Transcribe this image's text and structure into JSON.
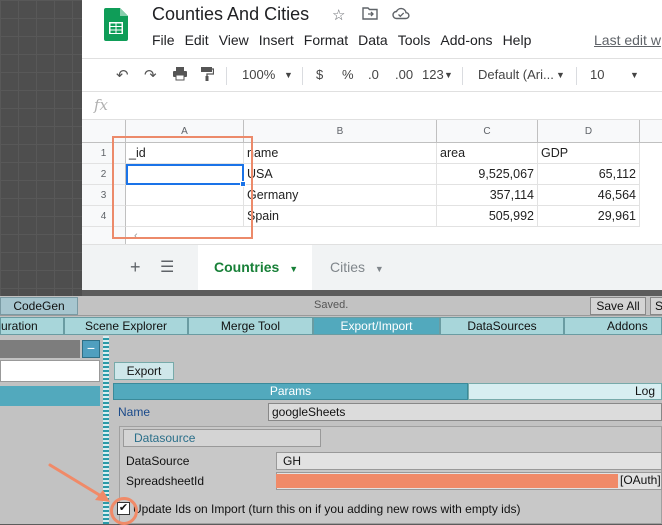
{
  "sheets": {
    "title": "Counties And Cities",
    "icons": {
      "star": "star-icon",
      "move": "folder-move-icon",
      "cloud": "cloud-saved-icon"
    },
    "menu": [
      "File",
      "Edit",
      "View",
      "Insert",
      "Format",
      "Data",
      "Tools",
      "Add-ons",
      "Help"
    ],
    "last_edit": "Last edit w",
    "toolbar": {
      "zoom": "100%",
      "currency": "$",
      "percent": "%",
      "dec_decrease": ".0",
      "dec_increase": ".00",
      "more_formats": "123",
      "font": "Default (Ari...",
      "font_size": "10"
    },
    "fx": "fx",
    "columns": [
      "A",
      "B",
      "C",
      "D"
    ],
    "rows": [
      {
        "num": "1",
        "cells": [
          "_id",
          "name",
          "area",
          "GDP"
        ]
      },
      {
        "num": "2",
        "cells": [
          "",
          "USA",
          "9,525,067",
          "65,112"
        ]
      },
      {
        "num": "3",
        "cells": [
          "",
          "Germany",
          "357,114",
          "46,564"
        ]
      },
      {
        "num": "4",
        "cells": [
          "",
          "Spain",
          "505,992",
          "29,961"
        ]
      }
    ],
    "tabs": [
      {
        "label": "Countries",
        "active": true
      },
      {
        "label": "Cities",
        "active": false
      }
    ]
  },
  "unity": {
    "codegen": "CodeGen",
    "saved": "Saved.",
    "save_all": "Save All",
    "s_button": "S",
    "tabs": [
      "uration",
      "Scene Explorer",
      "Merge Tool",
      "Export/Import",
      "DataSources",
      "Addons"
    ],
    "active_tab": "Export/Import",
    "minus": "−",
    "export_button": "Export",
    "params_tab": "Params",
    "log_tab": "Log",
    "name_label": "Name",
    "name_value": "googleSheets",
    "datasource_tab": "Datasource",
    "datasource_label": "DataSource",
    "datasource_value": "GH",
    "sheetid_label": "SpreadsheetId",
    "oauth": "[OAuth]",
    "checkbox_mark": "✔",
    "update_label": "Update Ids on Import (turn this on if you adding new rows with empty ids)"
  },
  "colors": {
    "sheets_green": "#188038",
    "selection_blue": "#1a73e8",
    "unity_accent": "#52a9bd",
    "annotation_orange": "#f08a68"
  }
}
